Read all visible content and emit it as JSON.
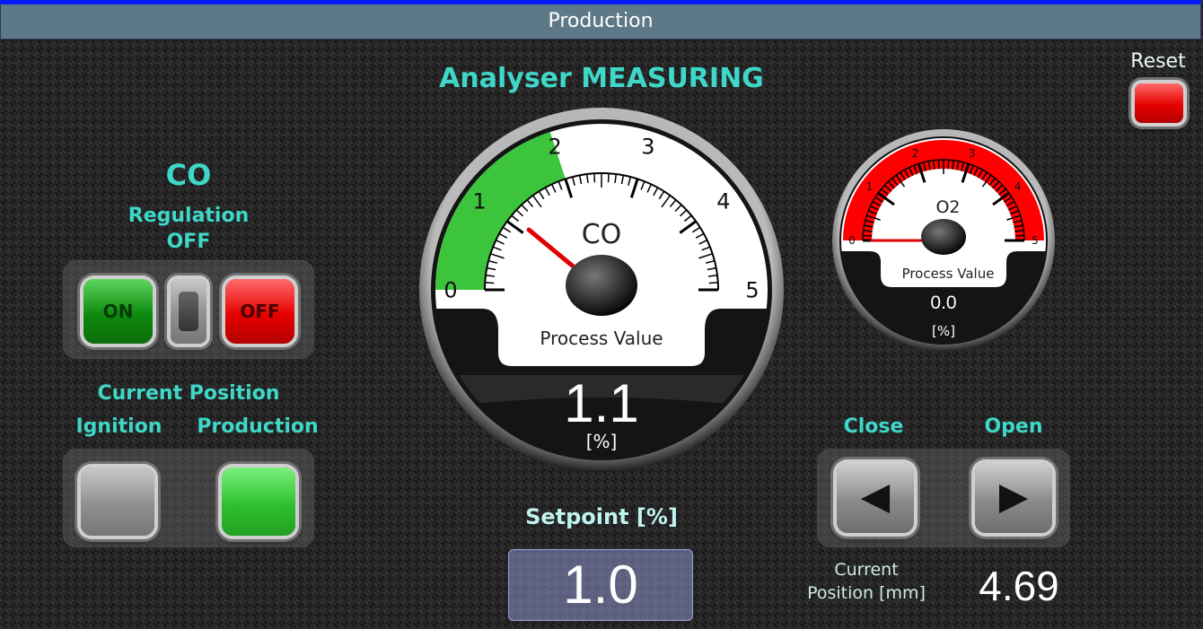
{
  "header": {
    "title": "Production"
  },
  "status": {
    "title": "Analyser MEASURING"
  },
  "reset": {
    "label": "Reset"
  },
  "regulation": {
    "name": "CO",
    "label": "Regulation",
    "state": "OFF",
    "on_label": "ON",
    "off_label": "OFF"
  },
  "position": {
    "title": "Current Position",
    "ignition_label": "Ignition",
    "production_label": "Production"
  },
  "co_gauge": {
    "name": "CO",
    "caption": "Process Value",
    "value": "1.1",
    "unit": "[%]",
    "ticks": [
      "0",
      "1",
      "2",
      "3",
      "4",
      "5"
    ],
    "min": 0,
    "max": 5,
    "reading": 1.1,
    "green_zone_end": 2,
    "zone_color": "#3cc43c"
  },
  "o2_gauge": {
    "name": "O2",
    "caption": "Process Value",
    "value": "0.0",
    "unit": "[%]",
    "ticks": [
      "0",
      "1",
      "2",
      "3",
      "4",
      "5"
    ],
    "min": 0,
    "max": 5,
    "reading": 0.0,
    "zone_color": "#ff0000"
  },
  "setpoint": {
    "label": "Setpoint [%]",
    "value": "1.0"
  },
  "damper": {
    "close_label": "Close",
    "open_label": "Open",
    "position_label_line1": "Current",
    "position_label_line2": "Position [mm]",
    "position_value": "4.69"
  },
  "colors": {
    "accent": "#3ed7c8",
    "header_bg": "#5d7886",
    "header_border": "#0019ff"
  }
}
